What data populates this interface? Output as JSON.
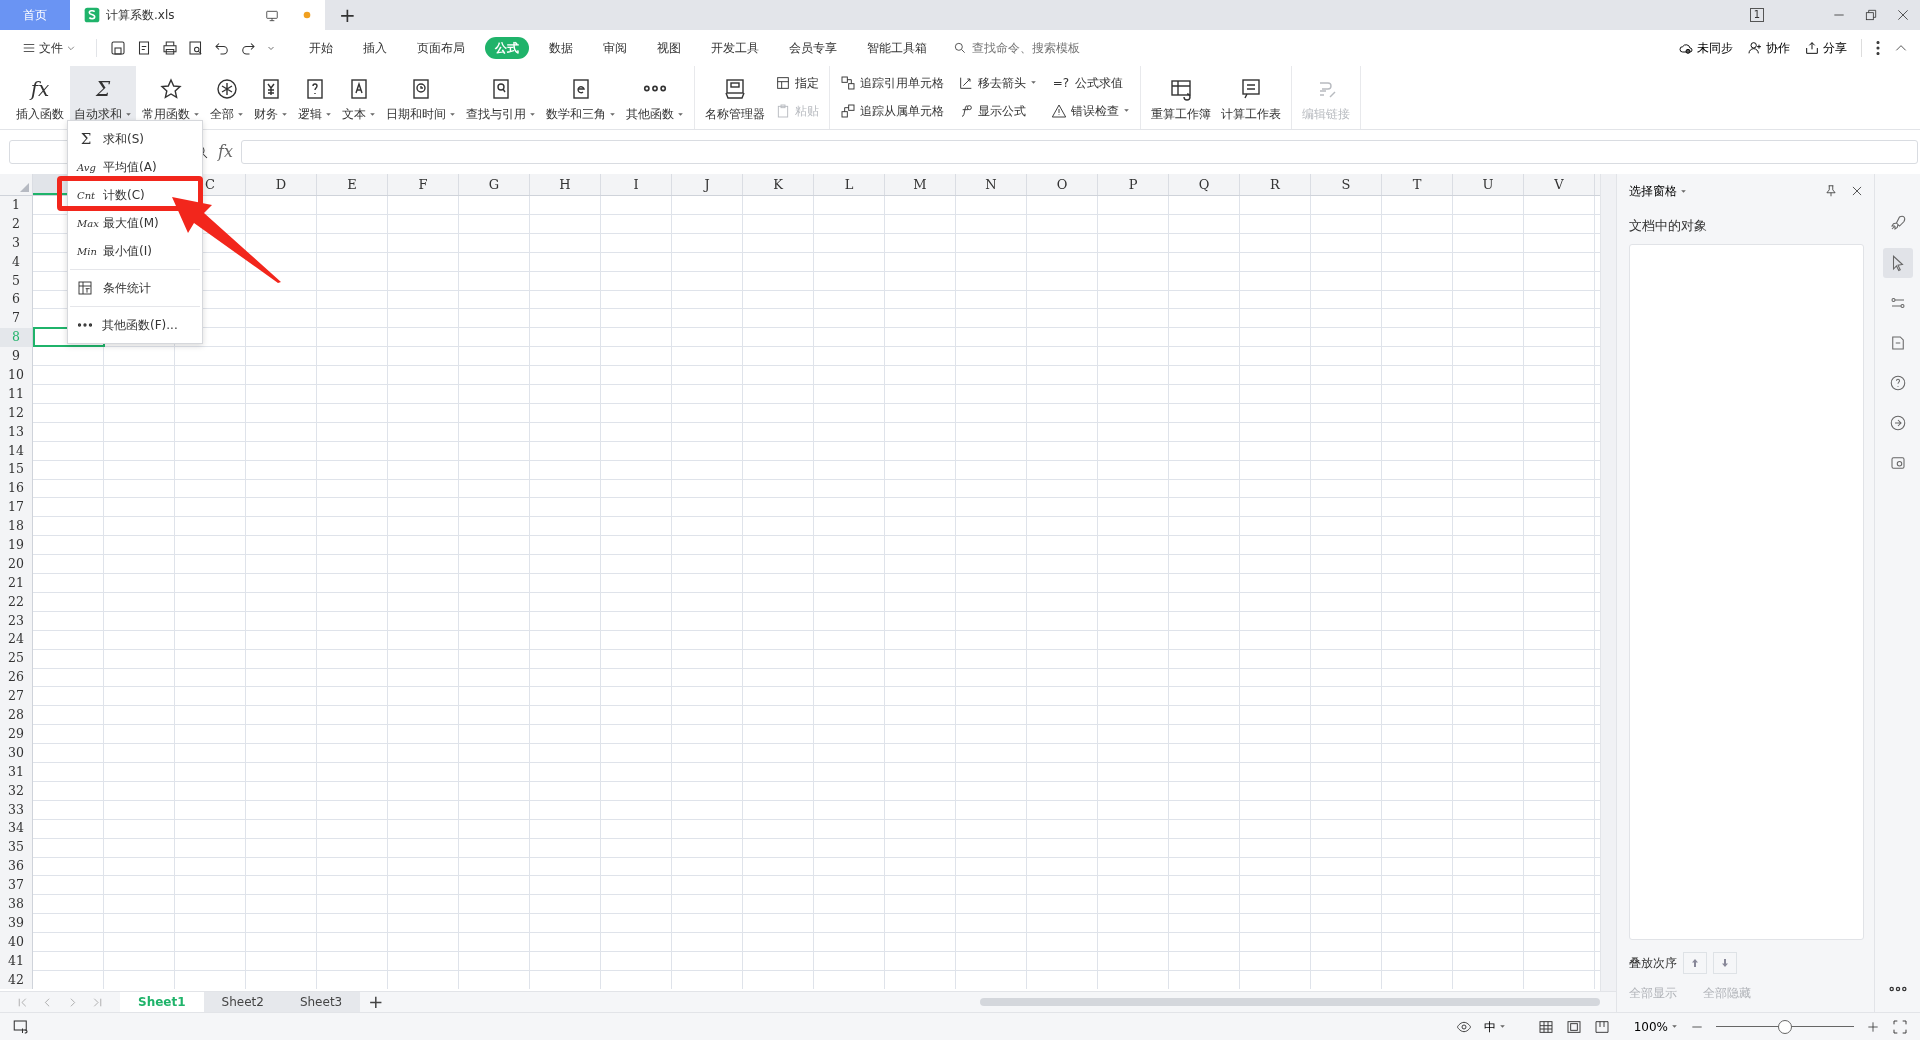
{
  "title_bar": {
    "tabs": [
      {
        "label": "首页",
        "kind": "home",
        "selected": false
      },
      {
        "label": "计算系数.xls",
        "kind": "file",
        "selected": true,
        "unsaved": true
      }
    ],
    "new_tab": "+",
    "window_badge": "1"
  },
  "menu_bar": {
    "file_menu": "文件",
    "tabs": [
      {
        "label": "开始",
        "selected": false
      },
      {
        "label": "插入",
        "selected": false
      },
      {
        "label": "页面布局",
        "selected": false
      },
      {
        "label": "公式",
        "selected": true
      },
      {
        "label": "数据",
        "selected": false
      },
      {
        "label": "审阅",
        "selected": false
      },
      {
        "label": "视图",
        "selected": false
      },
      {
        "label": "开发工具",
        "selected": false
      },
      {
        "label": "会员专享",
        "selected": false
      },
      {
        "label": "智能工具箱",
        "selected": false
      }
    ],
    "search": {
      "placeholder": "查找命令、搜索模板"
    },
    "actions": [
      "未同步",
      "协作",
      "分享"
    ]
  },
  "ribbon": {
    "groups": [
      {
        "items": [
          {
            "label": "插入函数",
            "kind": "large",
            "glyph": "fx",
            "dropdown": false,
            "pressed": false,
            "disabled": false
          },
          {
            "label": "自动求和",
            "kind": "large",
            "glyph": "Σ",
            "dropdown": true,
            "pressed": true,
            "disabled": false
          },
          {
            "label": "常用函数",
            "kind": "large",
            "dropdown": true,
            "pressed": false,
            "disabled": false
          },
          {
            "label": "全部",
            "kind": "large",
            "dropdown": true,
            "pressed": false,
            "disabled": false
          },
          {
            "label": "财务",
            "kind": "large",
            "dropdown": true,
            "pressed": false,
            "disabled": false
          },
          {
            "label": "逻辑",
            "kind": "large",
            "dropdown": true,
            "pressed": false,
            "disabled": false
          },
          {
            "label": "文本",
            "kind": "large",
            "dropdown": true,
            "pressed": false,
            "disabled": false
          },
          {
            "label": "日期和时间",
            "kind": "large",
            "dropdown": true,
            "pressed": false,
            "disabled": false
          },
          {
            "label": "查找与引用",
            "kind": "large",
            "dropdown": true,
            "pressed": false,
            "disabled": false
          },
          {
            "label": "数学和三角",
            "kind": "large",
            "dropdown": true,
            "pressed": false,
            "disabled": false
          },
          {
            "label": "其他函数",
            "kind": "large",
            "dropdown": true,
            "pressed": false,
            "disabled": false
          }
        ]
      },
      {
        "items": [
          {
            "label": "名称管理器",
            "kind": "large",
            "dropdown": false,
            "pressed": false,
            "disabled": false
          },
          {
            "label": "指定",
            "kind": "small",
            "dropdown": false,
            "pressed": false,
            "disabled": false
          },
          {
            "label": "粘贴",
            "kind": "small",
            "dropdown": false,
            "pressed": false,
            "disabled": true
          }
        ]
      },
      {
        "items": [
          {
            "label": "追踪引用单元格",
            "kind": "small",
            "dropdown": false,
            "pressed": false,
            "disabled": false
          },
          {
            "label": "追踪从属单元格",
            "kind": "small",
            "dropdown": false,
            "pressed": false,
            "disabled": false
          },
          {
            "label": "移去箭头",
            "kind": "small",
            "dropdown": true,
            "pressed": false,
            "disabled": false
          },
          {
            "label": "显示公式",
            "kind": "small",
            "dropdown": false,
            "pressed": false,
            "disabled": false
          },
          {
            "label": "公式求值",
            "kind": "small",
            "glyph": "=?",
            "dropdown": false,
            "pressed": false,
            "disabled": false
          },
          {
            "label": "错误检查",
            "kind": "small",
            "dropdown": true,
            "pressed": false,
            "disabled": false
          }
        ]
      },
      {
        "items": [
          {
            "label": "重算工作簿",
            "kind": "large",
            "dropdown": false,
            "pressed": false,
            "disabled": false
          },
          {
            "label": "计算工作表",
            "kind": "large",
            "dropdown": false,
            "pressed": false,
            "disabled": false
          }
        ]
      },
      {
        "items": [
          {
            "label": "编辑链接",
            "kind": "large",
            "dropdown": false,
            "pressed": false,
            "disabled": true
          }
        ]
      }
    ]
  },
  "formula_bar": {
    "fx": "fx"
  },
  "dropdown_menu": {
    "items": [
      {
        "kind": "item",
        "glyph": "Σ",
        "label": "求和(S)"
      },
      {
        "kind": "item",
        "glyph": "Avg",
        "label": "平均值(A)"
      },
      {
        "kind": "item",
        "glyph": "Cnt",
        "label": "计数(C)"
      },
      {
        "kind": "item",
        "glyph": "Max",
        "label": "最大值(M)"
      },
      {
        "kind": "item",
        "glyph": "Min",
        "label": "最小值(I)"
      },
      {
        "kind": "separator"
      },
      {
        "kind": "icon-item",
        "label": "条件统计"
      },
      {
        "kind": "separator"
      },
      {
        "kind": "icon-item",
        "label": "其他函数(F)..."
      }
    ]
  },
  "grid": {
    "columns": [
      "C",
      "D",
      "E",
      "F",
      "G",
      "H",
      "I",
      "J",
      "K",
      "L",
      "M",
      "N",
      "O",
      "P",
      "Q",
      "R",
      "S",
      "T",
      "U",
      "V"
    ],
    "rows": [
      {
        "label": "1",
        "selected": false
      },
      {
        "label": "2",
        "selected": false
      },
      {
        "label": "3",
        "selected": false
      },
      {
        "label": "4",
        "selected": false
      },
      {
        "label": "5",
        "selected": false
      },
      {
        "label": "6",
        "selected": false
      },
      {
        "label": "7",
        "selected": false
      },
      {
        "label": "8",
        "selected": true
      },
      {
        "label": "9",
        "selected": false
      },
      {
        "label": "10",
        "selected": false
      },
      {
        "label": "11",
        "selected": false
      },
      {
        "label": "12",
        "selected": false
      },
      {
        "label": "13",
        "selected": false
      },
      {
        "label": "14",
        "selected": false
      },
      {
        "label": "15",
        "selected": false
      },
      {
        "label": "16",
        "selected": false
      },
      {
        "label": "17",
        "selected": false
      },
      {
        "label": "18",
        "selected": false
      },
      {
        "label": "19",
        "selected": false
      },
      {
        "label": "20",
        "selected": false
      },
      {
        "label": "21",
        "selected": false
      },
      {
        "label": "22",
        "selected": false
      },
      {
        "label": "23",
        "selected": false
      },
      {
        "label": "24",
        "selected": false
      },
      {
        "label": "25",
        "selected": false
      },
      {
        "label": "26",
        "selected": false
      },
      {
        "label": "27",
        "selected": false
      },
      {
        "label": "28",
        "selected": false
      },
      {
        "label": "29",
        "selected": false
      },
      {
        "label": "30",
        "selected": false
      },
      {
        "label": "31",
        "selected": false
      },
      {
        "label": "32",
        "selected": false
      },
      {
        "label": "33",
        "selected": false
      },
      {
        "label": "34",
        "selected": false
      },
      {
        "label": "35",
        "selected": false
      },
      {
        "label": "36",
        "selected": false
      },
      {
        "label": "37",
        "selected": false
      },
      {
        "label": "38",
        "selected": false
      },
      {
        "label": "39",
        "selected": false
      },
      {
        "label": "40",
        "selected": false
      },
      {
        "label": "41",
        "selected": false
      },
      {
        "label": "42",
        "selected": false
      }
    ]
  },
  "sheet_tabs": {
    "tabs": [
      {
        "label": "Sheet1",
        "selected": true
      },
      {
        "label": "Sheet2",
        "selected": false
      },
      {
        "label": "Sheet3",
        "selected": false
      }
    ],
    "add": "+"
  },
  "selection_pane": {
    "title": "选择窗格",
    "heading": "文档中的对象",
    "order_label": "叠放次序",
    "buttons": [
      {
        "label": "全部显示",
        "disabled": true
      },
      {
        "label": "全部隐藏",
        "disabled": true
      }
    ]
  },
  "side_tools": [
    {
      "selected": false
    },
    {
      "selected": true
    },
    {
      "selected": false
    },
    {
      "selected": false
    },
    {
      "selected": false
    },
    {
      "selected": false
    },
    {
      "selected": false
    }
  ],
  "status_bar": {
    "input_method": "中",
    "zoom": "100%",
    "zoom_slider": {
      "level": 0.5
    }
  },
  "annotations": {
    "highlight_box": true,
    "arrow": true
  }
}
